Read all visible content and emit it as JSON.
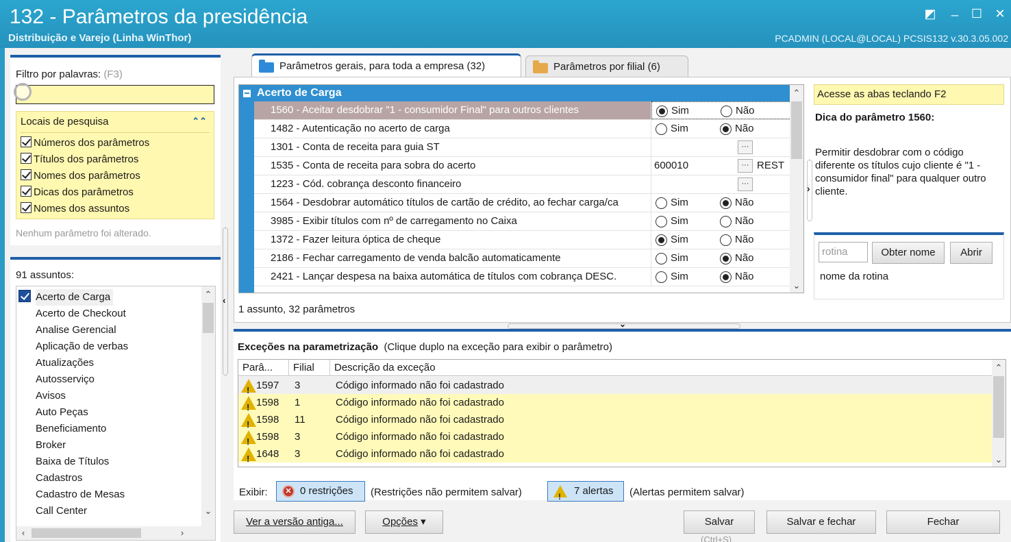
{
  "window": {
    "title": "132 - Parâmetros da presidência",
    "subtitle": "Distribuição e Varejo (Linha WinThor)",
    "userinfo": "PCADMIN (LOCAL@LOCAL)   PCSIS132  v.30.3.05.002"
  },
  "filter": {
    "label": "Filtro por palavras:",
    "shortcut": "(F3)",
    "value": "",
    "locais_title": "Locais de pesquisa",
    "options": [
      {
        "label": "Números dos parâmetros",
        "checked": true
      },
      {
        "label": "Títulos dos parâmetros",
        "checked": true
      },
      {
        "label": "Nomes dos parâmetros",
        "checked": true
      },
      {
        "label": "Dicas dos parâmetros",
        "checked": true
      },
      {
        "label": "Nomes dos assuntos",
        "checked": true
      }
    ],
    "status": "Nenhum parâmetro foi alterado."
  },
  "assuntos": {
    "count_label": "91 assuntos:",
    "items": [
      "Acerto de Carga",
      "Acerto de Checkout",
      "Analise Gerencial",
      "Aplicação de verbas",
      "Atualizações",
      "Autosserviço",
      "Avisos",
      "Auto Peças",
      "Beneficiamento",
      "Broker",
      "Baixa de Títulos",
      "Cadastros",
      "Cadastro de Mesas",
      "Call Center"
    ]
  },
  "tabs": [
    {
      "label": "Parâmetros gerais, para toda a empresa",
      "count": "(32)"
    },
    {
      "label": "Parâmetros por filial",
      "count": "(6)"
    }
  ],
  "params": {
    "group": "Acerto de Carga",
    "rows": [
      {
        "name": "1560 - Aceitar desdobrar \"1 - consumidor Final\" para outros clientes",
        "type": "radio",
        "value": "Sim"
      },
      {
        "name": "1482 - Autenticação no acerto de carga",
        "type": "radio",
        "value": "Não"
      },
      {
        "name": "1301 - Conta de receita para guia ST",
        "type": "lookup",
        "value": "",
        "extra": ""
      },
      {
        "name": "1535 - Conta de receita para sobra do acerto",
        "type": "lookup",
        "value": "600010",
        "extra": "REST"
      },
      {
        "name": "1223 - Cód. cobrança desconto financeiro",
        "type": "lookup",
        "value": "",
        "extra": ""
      },
      {
        "name": "1564 - Desdobrar automático títulos de cartão de crédito, ao fechar carga/ca",
        "type": "radio",
        "value": "Não"
      },
      {
        "name": "3985 - Exibir títulos com nº de carregamento no Caixa",
        "type": "radio",
        "value": "Não"
      },
      {
        "name": "1372 - Fazer leitura óptica de cheque",
        "type": "radio",
        "value": "Sim"
      },
      {
        "name": "2186 - Fechar carregamento de venda balcão automaticamente",
        "type": "radio",
        "value": "Não"
      },
      {
        "name": "2421 - Lançar despesa na baixa automática de títulos com cobrança DESC.",
        "type": "radio",
        "value": "Não"
      }
    ],
    "yes_label": "Sim",
    "no_label": "Não",
    "status": "1 assunto, 32 parâmetros"
  },
  "hint": {
    "top": "Acesse as abas teclando F2",
    "title": "Dica do parâmetro 1560:",
    "text": "Permitir desdobrar com o código diferente os títulos cujo cliente é \"1 - consumidor final\" para qualquer outro cliente.",
    "rotina_placeholder": "rotina",
    "obter_label": "Obter nome",
    "abrir_label": "Abrir",
    "rotina_name": "nome da rotina"
  },
  "exceptions": {
    "title": "Exceções na parametrização",
    "subtitle": "(Clique duplo na exceção para exibir o parâmetro)",
    "columns": [
      "Parâ...",
      "Filial",
      "Descrição da exceção"
    ],
    "rows": [
      {
        "param": "1597",
        "filial": "3",
        "desc": "Código informado não foi cadastrado"
      },
      {
        "param": "1598",
        "filial": "1",
        "desc": "Código informado não foi cadastrado"
      },
      {
        "param": "1598",
        "filial": "11",
        "desc": "Código informado não foi cadastrado"
      },
      {
        "param": "1598",
        "filial": "3",
        "desc": "Código informado não foi cadastrado"
      },
      {
        "param": "1648",
        "filial": "3",
        "desc": "Código informado não foi cadastrado"
      }
    ],
    "exibir_label": "Exibir:",
    "restricoes_label": "0 restrições",
    "restricoes_note": "(Restrições não permitem salvar)",
    "alertas_label": "7 alertas",
    "alertas_note": "(Alertas permitem salvar)"
  },
  "footer": {
    "versao_label": "Ver a versão antiga...",
    "opcoes_label": "Opções",
    "salvar_label": "Salvar",
    "salvar_fechar_label": "Salvar e fechar",
    "fechar_label": "Fechar",
    "salvar_shortcut": "(Ctrl+S)"
  },
  "colors": {
    "accent": "#1e5fa8",
    "group": "#2f8fd0",
    "titlebar": "#2592bd",
    "highlight": "#fff8b0"
  }
}
